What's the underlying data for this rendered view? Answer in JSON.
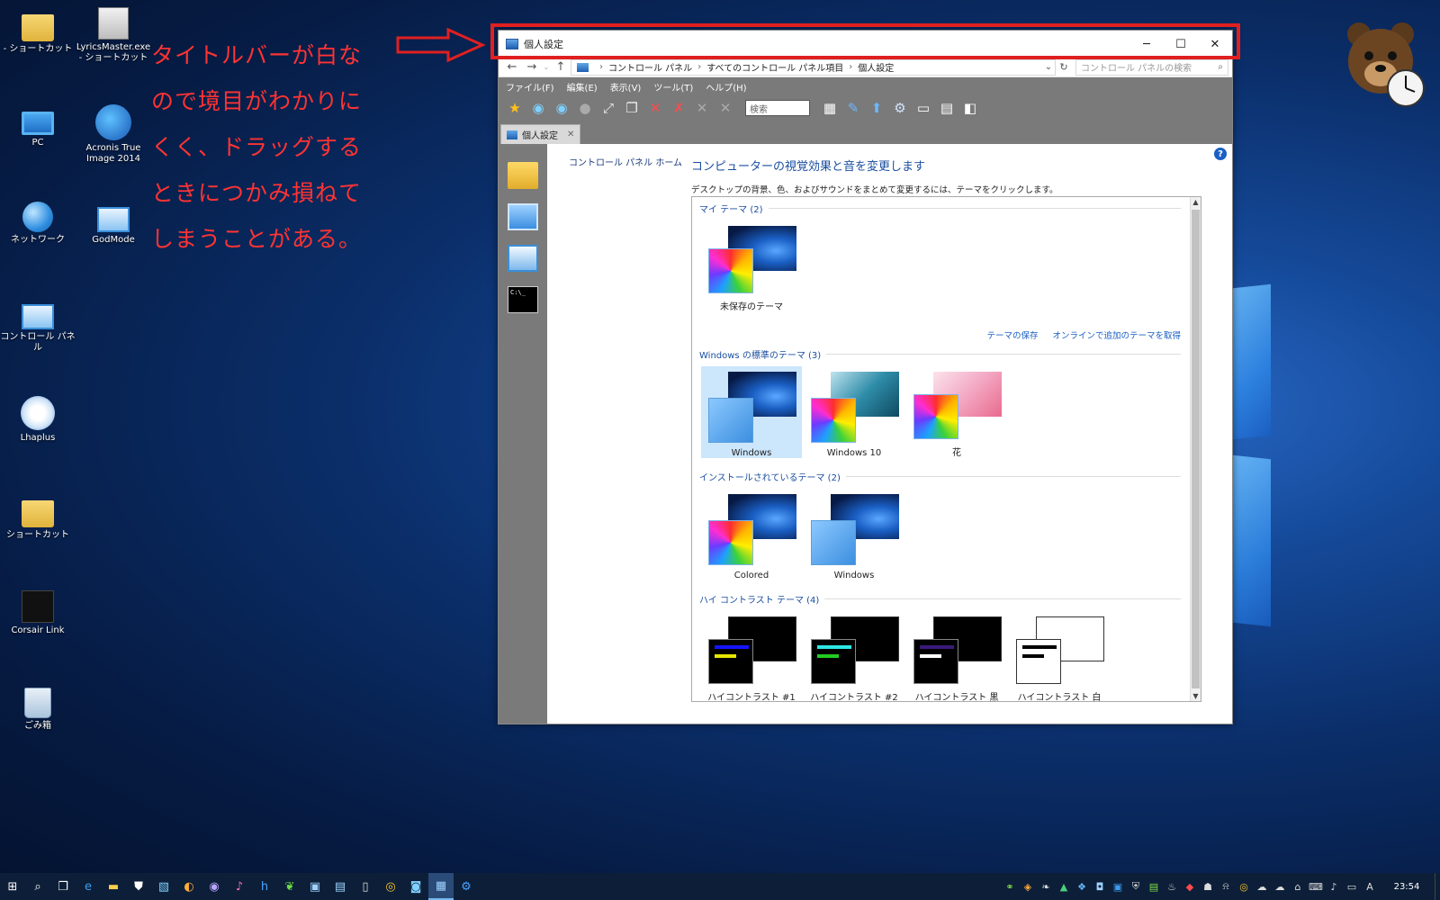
{
  "desktop": {
    "icons": [
      {
        "label": "- ショートカット"
      },
      {
        "label": "LyricsMaster.exe - ショートカット"
      },
      {
        "label": "PC"
      },
      {
        "label": "Acronis True Image 2014"
      },
      {
        "label": "ネットワーク"
      },
      {
        "label": "GodMode"
      },
      {
        "label": "コントロール パネル"
      },
      {
        "label": "Lhaplus"
      },
      {
        "label": "ショートカット"
      },
      {
        "label": "Corsair Link"
      },
      {
        "label": "ごみ箱"
      }
    ]
  },
  "annotation": {
    "text": "タイトルバーが白なので境目がわかりにくく、ドラッグするときにつかみ損ねてしまうことがある。",
    "color": "#ff3333"
  },
  "window": {
    "title": "個人設定",
    "controls": {
      "minimize": "─",
      "maximize": "☐",
      "close": "✕"
    },
    "address": {
      "crumbs": [
        "コントロール パネル",
        "すべてのコントロール パネル項目",
        "個人設定"
      ],
      "search_placeholder": "コントロール パネルの検索"
    },
    "menu": [
      "ファイル(F)",
      "編集(E)",
      "表示(V)",
      "ツール(T)",
      "ヘルプ(H)"
    ],
    "toolbar_search": "検索",
    "tab_label": "個人設定",
    "leftnav": {
      "home": "コントロール パネル ホーム"
    },
    "main": {
      "title": "コンピューターの視覚効果と音を変更します",
      "description": "デスクトップの背景、色、およびサウンドをまとめて変更するには、テーマをクリックします。",
      "links": {
        "save": "テーマの保存",
        "online": "オンラインで追加のテーマを取得"
      },
      "groups": [
        {
          "title": "マイ テーマ (2)",
          "themes": [
            {
              "label": "未保存のテーマ"
            }
          ]
        },
        {
          "title": "Windows の標準のテーマ (3)",
          "themes": [
            {
              "label": "Windows"
            },
            {
              "label": "Windows 10"
            },
            {
              "label": "花"
            }
          ]
        },
        {
          "title": "インストールされているテーマ (2)",
          "themes": [
            {
              "label": "Colored"
            },
            {
              "label": "Windows"
            }
          ]
        },
        {
          "title": "ハイ コントラスト テーマ (4)",
          "themes": [
            {
              "label": "ハイコントラスト #1"
            },
            {
              "label": "ハイコントラスト #2"
            },
            {
              "label": "ハイコントラスト 黒"
            },
            {
              "label": "ハイコントラスト 白"
            }
          ]
        }
      ]
    }
  },
  "taskbar": {
    "clock": "23:54",
    "ime": "A",
    "accent": "#76b9ed"
  }
}
